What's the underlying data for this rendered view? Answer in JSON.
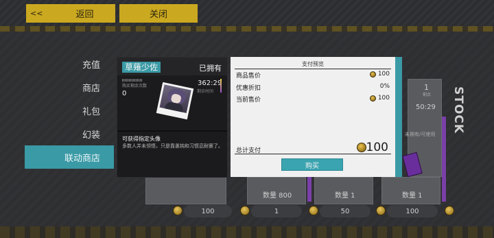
{
  "topbar": {
    "back_arrow": "<<",
    "back_label": "返回",
    "close_label": "关闭"
  },
  "nav": {
    "items": [
      {
        "label": "充值",
        "active": false
      },
      {
        "label": "商店",
        "active": false
      },
      {
        "label": "礼包",
        "active": false
      },
      {
        "label": "幻装",
        "active": false
      },
      {
        "label": "联动商店",
        "active": true
      }
    ]
  },
  "card": {
    "name": "草薙少佐",
    "owned": "已拥有",
    "sub_label": "购买剩余次数",
    "count": "0",
    "time": "362:29",
    "time_label": "剩余时间",
    "desc_title": "可获得指定头像",
    "desc": "多数人并未领悟，只是靠愚钝和习惯忍耐罢了。"
  },
  "payment": {
    "title": "支付预览",
    "rows": [
      {
        "label": "商品售价",
        "value": "100",
        "coin": true
      },
      {
        "label": "优惠折扣",
        "value": "0%",
        "coin": false
      },
      {
        "label": "当前售价",
        "value": "100",
        "coin": true
      }
    ],
    "total_label": "总计支付",
    "total_value": "100",
    "buy_label": "购买"
  },
  "shop_bg": {
    "stock_text": "STOCK",
    "slot_top_count": "1",
    "slot_top_count_label": "剩余",
    "slot_top_time": "50:29",
    "slot_top_sub": "未拥有/可使用",
    "quantities": [
      "数量 800",
      "数量 1",
      "数量 1"
    ],
    "prices": [
      "100",
      "1",
      "50",
      "100"
    ]
  },
  "colors": {
    "accent": "#3a9aa6",
    "gold_button": "#caa820",
    "purple": "#7a3fa8"
  }
}
